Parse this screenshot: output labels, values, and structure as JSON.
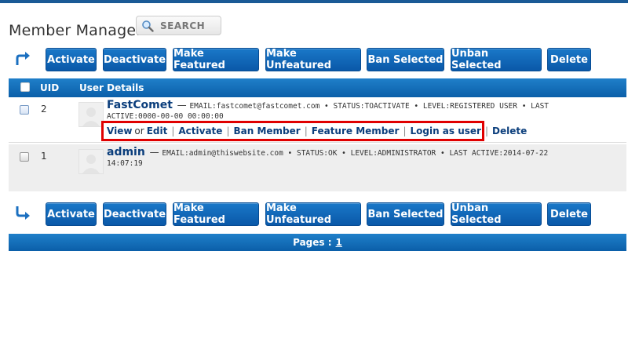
{
  "page": {
    "title": "Member Manager",
    "search_label": "SEARCH"
  },
  "toolbar": {
    "activate": "Activate",
    "deactivate": "Deactivate",
    "make_featured": "Make Featured",
    "make_unfeatured": "Make Unfeatured",
    "ban_selected": "Ban Selected",
    "unban_selected": "Unban Selected",
    "delete": "Delete"
  },
  "table": {
    "headers": {
      "uid": "UID",
      "details": "User Details"
    },
    "rows": [
      {
        "uid": "2",
        "username": "FastComet",
        "meta_line1": "EMAIL:fastcomet@fastcomet.com • STATUS:TOACTIVATE • LEVEL:REGISTERED USER • LAST",
        "meta_line2": "ACTIVE:0000-00-00 00:00:00",
        "actions": {
          "view": "View",
          "or": "or",
          "edit": "Edit",
          "activate": "Activate",
          "ban": "Ban Member",
          "feature": "Feature Member",
          "login_as": "Login as user",
          "delete": "Delete"
        }
      },
      {
        "uid": "1",
        "username": "admin",
        "meta_line1": "EMAIL:admin@thiswebsite.com • STATUS:OK • LEVEL:ADMINISTRATOR • LAST ACTIVE:2014-07-22",
        "meta_line2": "14:07:19"
      }
    ]
  },
  "pagination": {
    "label": "Pages :",
    "current": "1"
  },
  "colors": {
    "accent_blue": "#0b5fa9",
    "highlight_red": "#e00000",
    "link_blue": "#0b3e7c"
  }
}
